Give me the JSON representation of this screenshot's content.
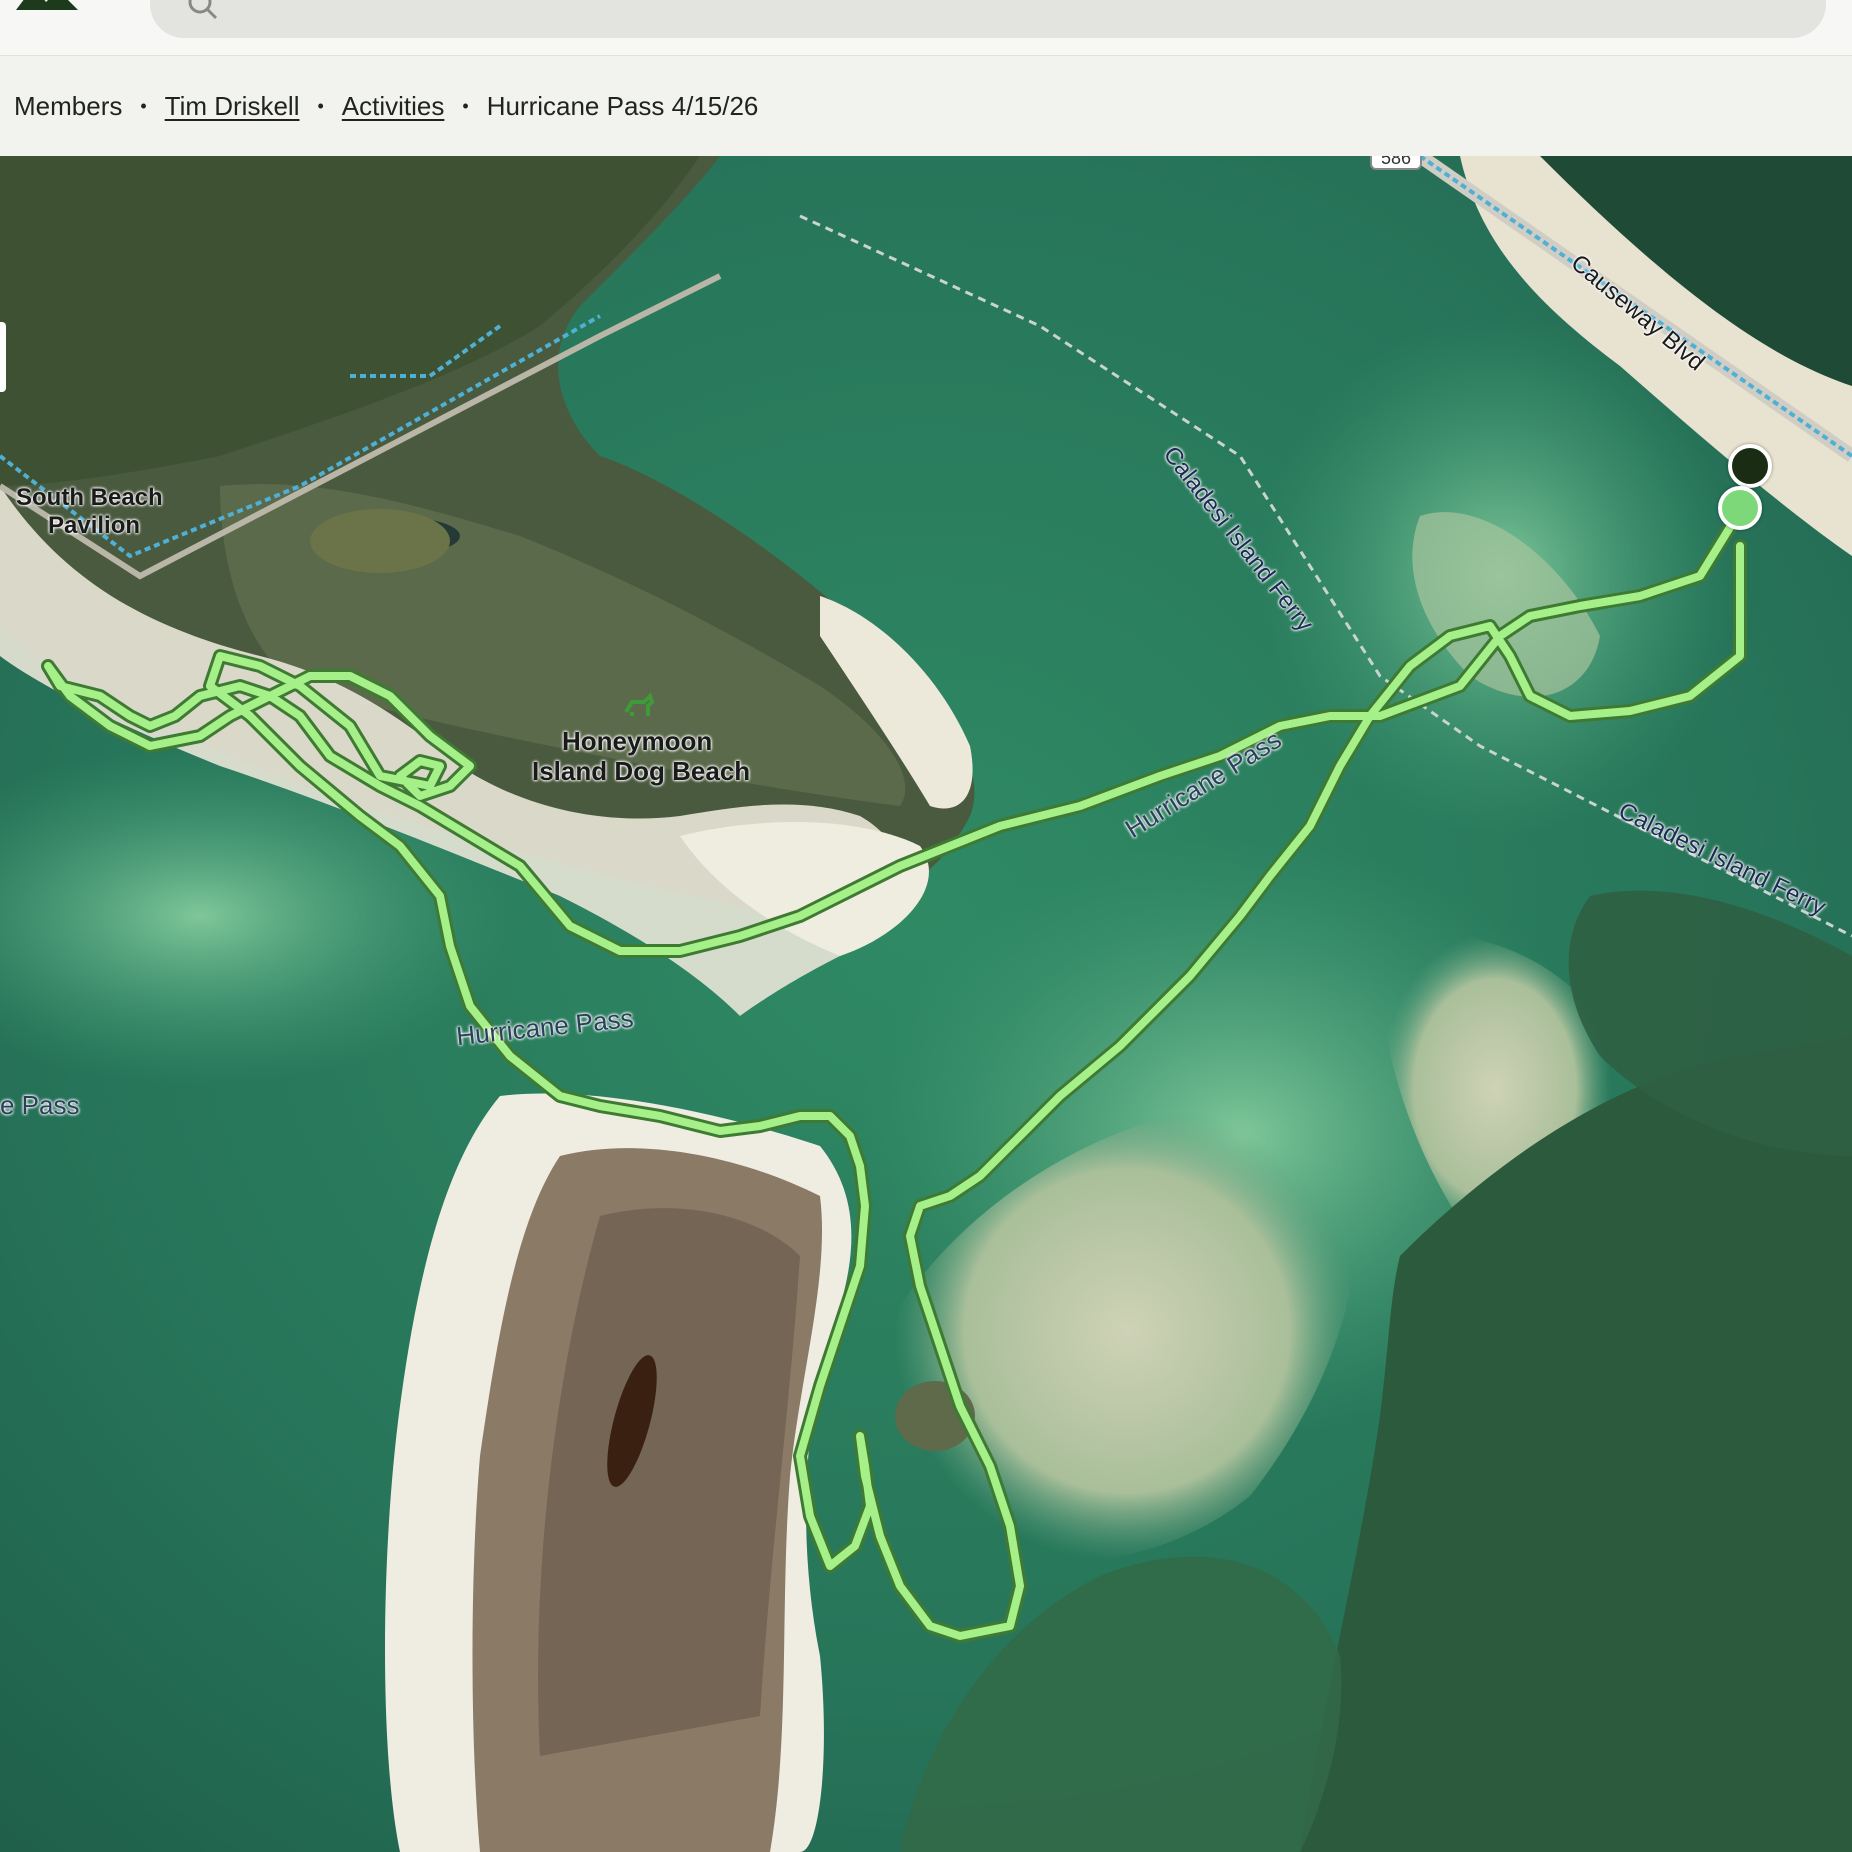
{
  "search": {
    "placeholder": ""
  },
  "icons": {
    "logo": "logo-icon",
    "search": "search-icon"
  },
  "breadcrumb": {
    "members": "Members",
    "athlete": "Tim Driskell",
    "activities": "Activities",
    "current": "Hurricane Pass 4/15/26",
    "separator": "•"
  },
  "map": {
    "labels": {
      "south_beach_1": "South Beach",
      "south_beach_2": "Pavilion",
      "dog_beach_1": "Honeymoon",
      "dog_beach_2": "Island Dog Beach",
      "hurricane_pass_mid": "Hurricane Pass",
      "hurricane_pass_upper": "Hurricane Pass",
      "hurricane_pass_edge": "e Pass",
      "ferry_1": "Caladesi Island Ferry",
      "ferry_2": "Caladesi Island Ferry",
      "causeway": "Causeway Blvd",
      "route_shield": "586"
    },
    "colors": {
      "track": "#a6f08a",
      "track_outline": "#3f7a33",
      "start": "#7dd87a",
      "end": "#1a2d14"
    }
  }
}
